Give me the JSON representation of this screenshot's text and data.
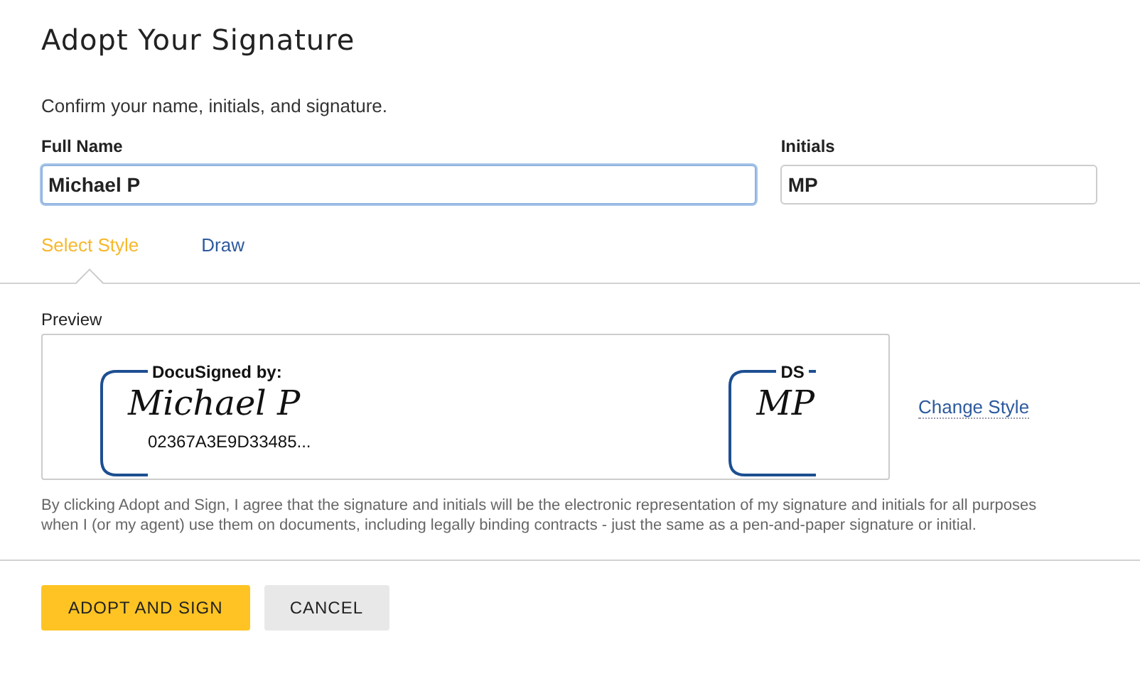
{
  "dialog": {
    "title": "Adopt Your Signature",
    "instructions": "Confirm your name, initials, and signature."
  },
  "fields": [
    {
      "label": "Full Name",
      "value": "Michael P",
      "focused": true
    },
    {
      "label": "Initials",
      "value": "MP",
      "focused": false
    }
  ],
  "tabs": [
    {
      "label": "Select Style",
      "selected": true
    },
    {
      "label": "Draw",
      "selected": false
    }
  ],
  "preview": {
    "label": "Preview",
    "signature": {
      "header": "DocuSigned by:",
      "script": "Michael P",
      "id": "02367A3E9D33485..."
    },
    "initials": {
      "header": "DS",
      "script": "MP"
    },
    "change_style": "Change Style"
  },
  "disclaimer": "By clicking Adopt and Sign, I agree that the signature and initials will be the electronic representation of my signature and initials for all purposes when I (or my agent) use them on documents, including legally binding contracts - just the same as a pen-and-paper signature or initial.",
  "buttons": [
    {
      "label": "ADOPT AND SIGN",
      "kind": "primary"
    },
    {
      "label": "CANCEL",
      "kind": "secondary"
    }
  ]
}
